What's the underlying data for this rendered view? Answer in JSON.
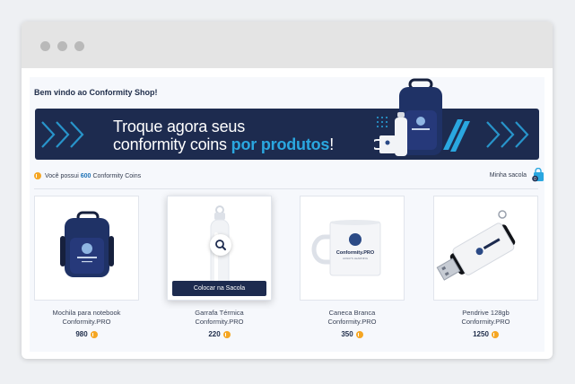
{
  "window": {
    "controls": [
      "dot",
      "dot",
      "dot"
    ]
  },
  "header": {
    "welcome": "Bem vindo ao Conformity Shop!"
  },
  "banner": {
    "line1": "Troque agora seus",
    "line2_prefix": "conformity coins ",
    "line2_highlight": "por produtos",
    "line2_suffix": "!"
  },
  "coins": {
    "prefix": "Você possui",
    "amount": "600",
    "suffix": "Conformity Coins"
  },
  "bag": {
    "label": "Minha sacola",
    "count": "0"
  },
  "products": [
    {
      "name_line1": "Mochila para notebook",
      "name_line2": "Conformity.PRO",
      "price": "980"
    },
    {
      "name_line1": "Garrafa Térmica",
      "name_line2": "Conformity.PRO",
      "price": "220",
      "button": "Colocar na Sacola"
    },
    {
      "name_line1": "Caneca Branca",
      "name_line2": "Conformity.PRO",
      "price": "350",
      "mug_brand": "Conformity.PRO",
      "mug_tagline": "ALWAYS LEARNING"
    },
    {
      "name_line1": "Pendrive 128gb",
      "name_line2": "Conformity.PRO",
      "price": "1250"
    }
  ],
  "colors": {
    "navy": "#1d2b4f",
    "accent": "#2aa7e0",
    "coin": "#f5a623"
  },
  "icons": [
    "coin-icon",
    "shopping-bag-icon",
    "magnifier-icon",
    "chevron-icon"
  ]
}
